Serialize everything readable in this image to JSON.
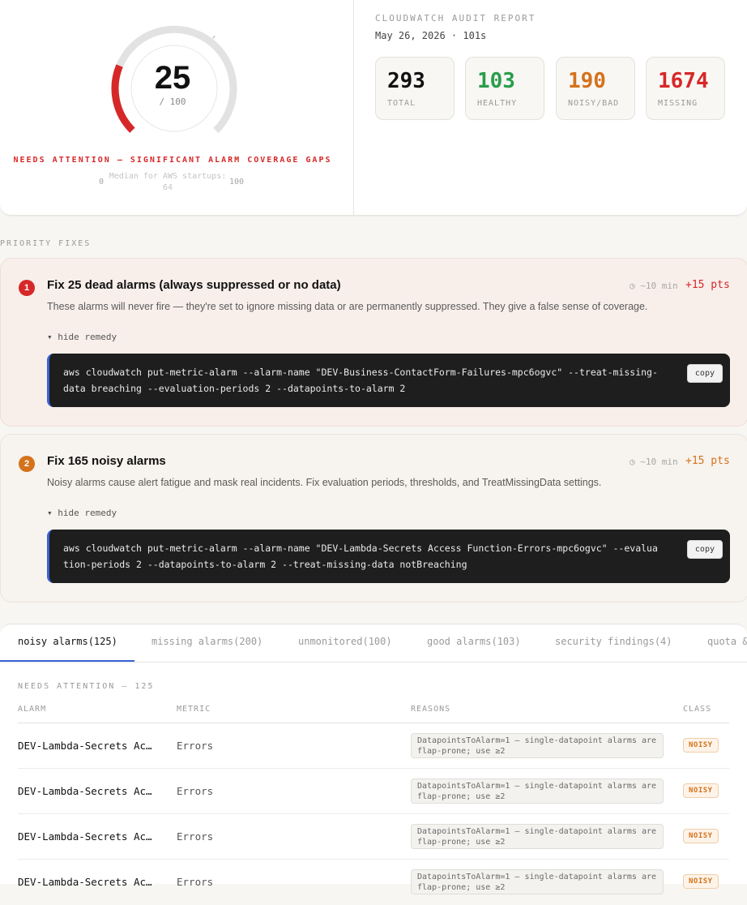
{
  "score": {
    "value": "25",
    "max_label": "/ 100",
    "fraction": 0.25,
    "verdict": "NEEDS ATTENTION — SIGNIFICANT ALARM COVERAGE GAPS",
    "scale_min": "0",
    "scale_max": "100",
    "median_text": "Median for AWS startups: 64",
    "median_value": 64,
    "colors": {
      "arc": "#d62828",
      "track": "#e2e2e2"
    }
  },
  "report": {
    "label": "CLOUDWATCH AUDIT REPORT",
    "date": "May 26, 2026 · 101s"
  },
  "stats": [
    {
      "value": "293",
      "label": "TOTAL",
      "color": "#111111"
    },
    {
      "value": "103",
      "label": "HEALTHY",
      "color": "#2a9d4b"
    },
    {
      "value": "190",
      "label": "NOISY/BAD",
      "color": "#d4721c"
    },
    {
      "value": "1674",
      "label": "MISSING",
      "color": "#d62828"
    }
  ],
  "priority": {
    "label": "PRIORITY FIXES",
    "fixes": [
      {
        "number": "1",
        "title": "Fix 25 dead alarms (always suppressed or no data)",
        "time": "~10 min",
        "points": "+15 pts",
        "description": "These alarms will never fire — they're set to ignore missing data or are permanently suppressed. They give a false sense of coverage.",
        "toggle": "▾ hide remedy",
        "command": "aws cloudwatch put-metric-alarm --alarm-name \"DEV-Business-ContactForm-Failures-mpc6ogvc\" --treat-missing-data breaching --evaluation-periods 2 --datapoints-to-alarm 2",
        "copy": "copy",
        "accent": "#d62828"
      },
      {
        "number": "2",
        "title": "Fix 165 noisy alarms",
        "time": "~10 min",
        "points": "+15 pts",
        "description": "Noisy alarms cause alert fatigue and mask real incidents. Fix evaluation periods, thresholds, and TreatMissingData settings.",
        "toggle": "▾ hide remedy",
        "command": "aws cloudwatch put-metric-alarm --alarm-name \"DEV-Lambda-Secrets Access Function-Errors-mpc6ogvc\" --evaluation-periods 2 --datapoints-to-alarm 2 --treat-missing-data notBreaching",
        "copy": "copy",
        "accent": "#d4721c"
      }
    ]
  },
  "tabs": [
    {
      "label": "noisy alarms(125)",
      "active": true
    },
    {
      "label": "missing alarms(200)",
      "active": false
    },
    {
      "label": "unmonitored(100)",
      "active": false
    },
    {
      "label": "good alarms(103)",
      "active": false
    },
    {
      "label": "security findings(4)",
      "active": false
    },
    {
      "label": "quota &",
      "active": false
    }
  ],
  "table": {
    "caption": "NEEDS ATTENTION — 125",
    "columns": [
      "ALARM",
      "METRIC",
      "REASONS",
      "CLASS"
    ],
    "rows": [
      {
        "alarm": "DEV-Lambda-Secrets Ac…",
        "metric": "Errors",
        "reason": "DatapointsToAlarm=1 — single-datapoint alarms are flap-prone; use ≥2",
        "class": "NOISY"
      },
      {
        "alarm": "DEV-Lambda-Secrets Ac…",
        "metric": "Errors",
        "reason": "DatapointsToAlarm=1 — single-datapoint alarms are flap-prone; use ≥2",
        "class": "NOISY"
      },
      {
        "alarm": "DEV-Lambda-Secrets Ac…",
        "metric": "Errors",
        "reason": "DatapointsToAlarm=1 — single-datapoint alarms are flap-prone; use ≥2",
        "class": "NOISY"
      },
      {
        "alarm": "DEV-Lambda-Secrets Ac…",
        "metric": "Errors",
        "reason": "DatapointsToAlarm=1 — single-datapoint alarms are flap-prone; use ≥2",
        "class": "NOISY"
      }
    ]
  }
}
